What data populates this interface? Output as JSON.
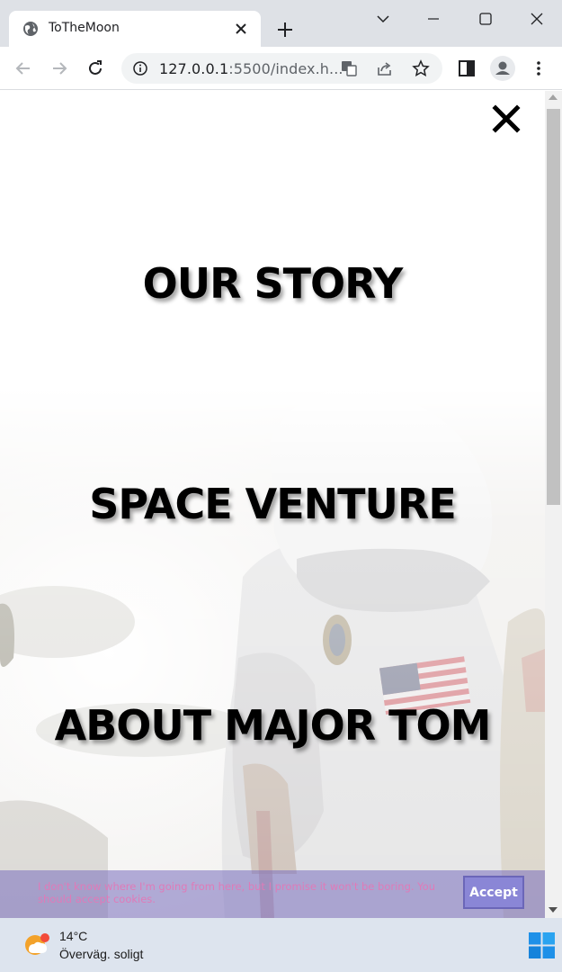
{
  "browser": {
    "tab": {
      "title": "ToTheMoon"
    },
    "address": {
      "host": "127.0.0.1",
      "rest": ":5500/index.h..."
    }
  },
  "page": {
    "menu": {
      "items": [
        {
          "label": "OUR STORY"
        },
        {
          "label": "SPACE VENTURE"
        },
        {
          "label": "ABOUT MAJOR TOM"
        }
      ]
    },
    "cookie_banner": {
      "message": "I don't know where I'm going from here, but I promise it won't be boring. You should accept cookies.",
      "accept_label": "Accept"
    }
  },
  "taskbar": {
    "weather": {
      "temperature": "14°C",
      "condition": "Överväg. soligt"
    }
  },
  "colors": {
    "tabstrip": "#dee1e6",
    "cookie_banner": "#786ebe",
    "cookie_text": "#e07ab8",
    "accept_button": "#8a86d6",
    "taskbar": "#dde4ee"
  },
  "icons": [
    "globe-icon",
    "close-icon",
    "plus-icon",
    "chevron-down-icon",
    "minimize-icon",
    "maximize-icon",
    "back-icon",
    "forward-icon",
    "reload-icon",
    "info-icon",
    "translate-icon",
    "share-icon",
    "star-icon",
    "side-panel-icon",
    "profile-icon",
    "more-icon",
    "weather-icon",
    "windows-start-icon"
  ]
}
